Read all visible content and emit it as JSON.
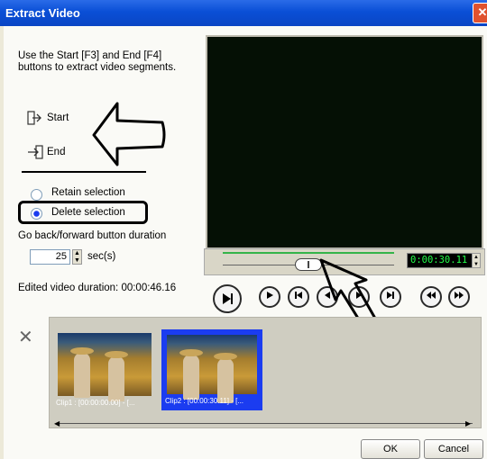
{
  "window": {
    "title": "Extract Video",
    "close_glyph": "✕"
  },
  "left_panel": {
    "instructions": "Use the Start [F3] and End [F4] buttons to extract video segments.",
    "start_label": "Start",
    "end_label": "End",
    "retain_label": "Retain selection",
    "delete_label": "Delete selection",
    "duration_label": "Go back/forward button duration",
    "duration_value": "25",
    "duration_unit": "sec(s)",
    "edited_duration": "Edited video duration: 00:00:46.16"
  },
  "player": {
    "timecode": "0:00:30.11",
    "controls": [
      "play-selection",
      "play",
      "prev",
      "back",
      "forward",
      "next",
      "rewind",
      "fast-forward"
    ]
  },
  "clips": [
    {
      "label": "Clip1 : [00:00:00.00] - [...",
      "selected": false
    },
    {
      "label": "Clip2 : [00:00:30.11] - [...",
      "selected": true
    }
  ],
  "buttons": {
    "ok": "OK",
    "cancel": "Cancel"
  },
  "colors": {
    "titlebar": "#0a4fd6",
    "timecode_text": "#23ff4a",
    "selection": "#1b3cf0"
  }
}
